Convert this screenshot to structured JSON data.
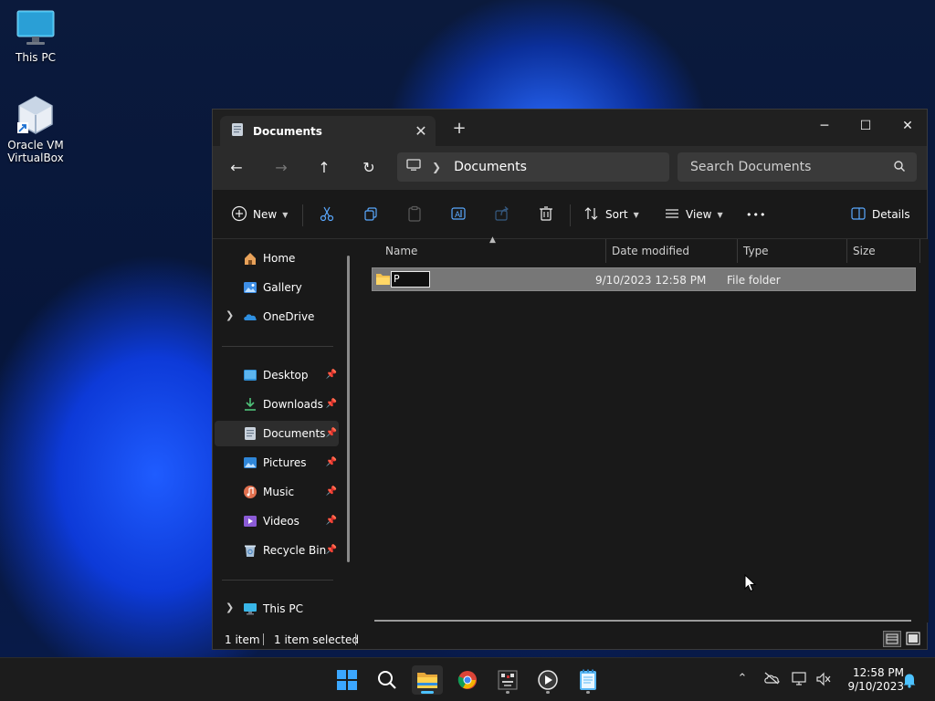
{
  "desktop": {
    "icons": [
      {
        "label": "This PC"
      },
      {
        "label": "Oracle VM VirtualBox"
      }
    ]
  },
  "window": {
    "tab_title": "Documents",
    "new_tab_glyph": "+",
    "controls": {
      "minimize": "─",
      "maximize": "☐",
      "close": "✕"
    },
    "nav": {
      "back": "←",
      "forward": "→",
      "up": "↑",
      "refresh": "↻"
    },
    "address": {
      "segments": [
        "Documents"
      ]
    },
    "search": {
      "placeholder": "Search Documents"
    },
    "toolbar": {
      "new_label": "New",
      "sort_label": "Sort",
      "view_label": "View",
      "more_glyph": "•••",
      "details_label": "Details"
    },
    "sidebar": {
      "items": [
        {
          "label": "Home",
          "icon": "home-icon"
        },
        {
          "label": "Gallery",
          "icon": "gallery-icon"
        },
        {
          "label": "OneDrive",
          "icon": "onedrive-icon"
        },
        {
          "label": "Desktop",
          "icon": "desktop-folder-icon"
        },
        {
          "label": "Downloads",
          "icon": "downloads-icon"
        },
        {
          "label": "Documents",
          "icon": "documents-icon"
        },
        {
          "label": "Pictures",
          "icon": "pictures-icon"
        },
        {
          "label": "Music",
          "icon": "music-icon"
        },
        {
          "label": "Videos",
          "icon": "videos-icon"
        },
        {
          "label": "Recycle Bin",
          "icon": "recycle-bin-icon"
        },
        {
          "label": "This PC",
          "icon": "this-pc-icon"
        }
      ],
      "selected": "Documents"
    },
    "columns": [
      {
        "label": "Name"
      },
      {
        "label": "Date modified"
      },
      {
        "label": "Type"
      },
      {
        "label": "Size"
      }
    ],
    "files": [
      {
        "rename_value": "P",
        "date_modified": "9/10/2023 12:58 PM",
        "type": "File folder",
        "size": ""
      }
    ],
    "status": {
      "items_count": "1 item",
      "selected_count": "1 item selected"
    }
  },
  "taskbar": {
    "apps": [
      "start-icon",
      "search-icon",
      "file-explorer-icon",
      "chrome-icon",
      "app-icon",
      "media-player-icon",
      "notepad-icon"
    ],
    "clock": {
      "time": "12:58 PM",
      "date": "9/10/2023"
    }
  },
  "colors": {
    "accent": "#4cc2ff",
    "selection_row": "#777777",
    "window_bg": "#191919",
    "chrome_bg": "#202020"
  }
}
